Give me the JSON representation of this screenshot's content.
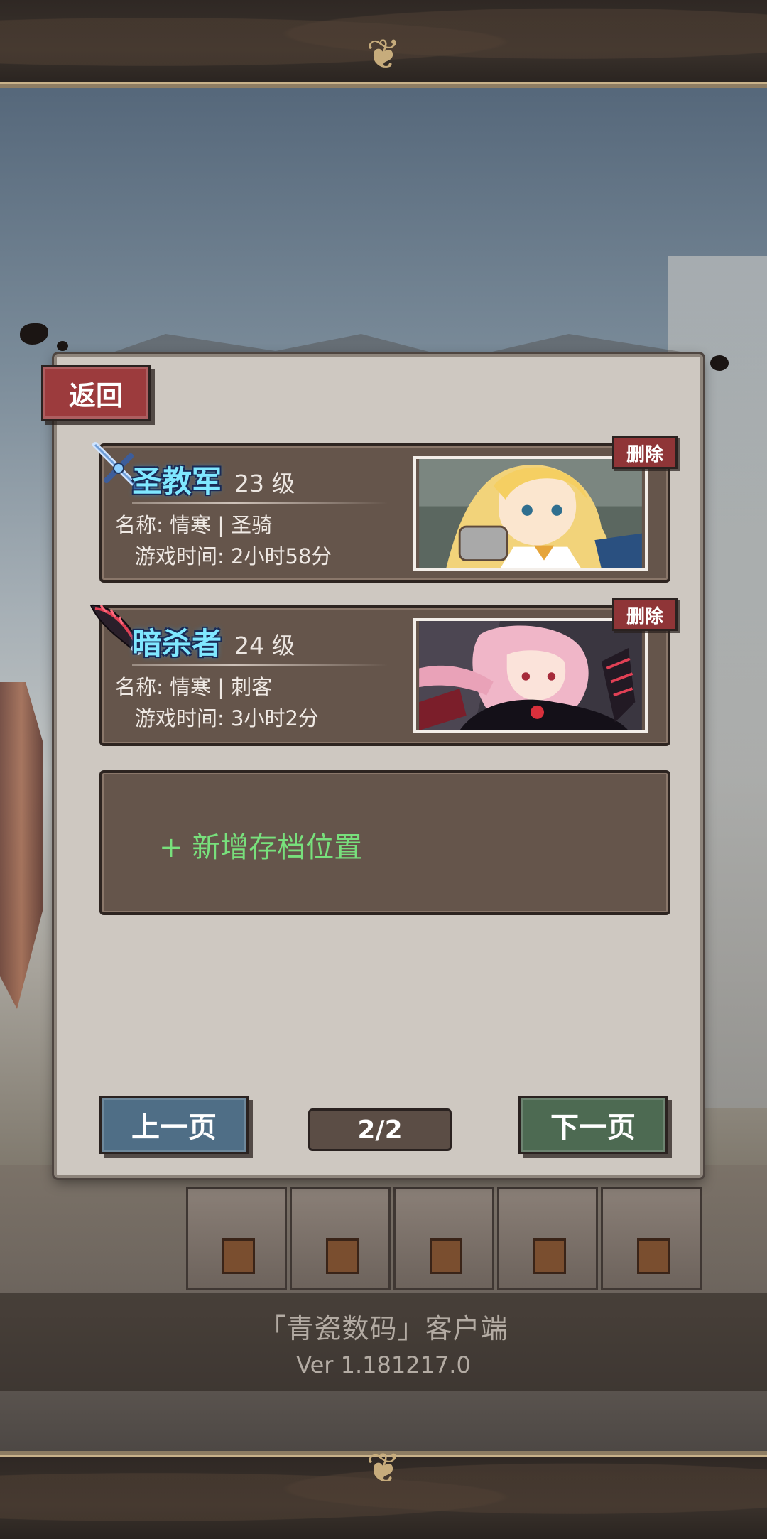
{
  "header": {
    "ornament": "❦"
  },
  "panel": {
    "back_label": "返回",
    "delete_label": "删除",
    "slots": [
      {
        "class_name": "圣教军",
        "level_label": "23 级",
        "name_line": "名称:  情寒 | 圣骑",
        "playtime_line": "游戏时间:  2小时58分",
        "weapon_icon": "holy-sword-icon",
        "portrait": "blonde-paladin-portrait"
      },
      {
        "class_name": "暗杀者",
        "level_label": "24 级",
        "name_line": "名称:  情寒 | 刺客",
        "playtime_line": "游戏时间:  3小时2分",
        "weapon_icon": "dark-dagger-icon",
        "portrait": "pink-haired-assassin-portrait"
      }
    ],
    "add_slot_label": "+ 新增存档位置",
    "prev_page_label": "上一页",
    "next_page_label": "下一页",
    "page_indicator": "2/2"
  },
  "footer": {
    "client_name": "「青瓷数码」客户端",
    "version": "Ver 1.181217.0"
  },
  "colors": {
    "class_name": "#7fe7ff",
    "add_slot": "#78e07c",
    "back_button": "#9c3b3d",
    "prev_button": "#4f6e86",
    "next_button": "#4d6a52",
    "slot_background": "#65554b",
    "panel_background": "#cec8c1"
  }
}
